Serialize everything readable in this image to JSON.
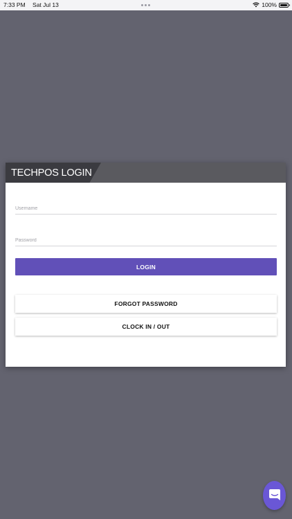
{
  "status_bar": {
    "time": "7:33 PM",
    "date": "Sat Jul 13",
    "battery": "100%"
  },
  "login": {
    "title": "TECHPOS LOGIN",
    "username_placeholder": "Username",
    "password_placeholder": "Password",
    "login_label": "LOGIN",
    "forgot_label": "FORGOT PASSWORD",
    "clock_label": "CLOCK IN / OUT"
  },
  "colors": {
    "background": "#63636f",
    "accent": "#6150b8",
    "chat": "#6a57d6"
  },
  "icons": {
    "chat": "chat-bubble-icon",
    "wifi": "wifi-icon",
    "battery": "battery-icon"
  }
}
